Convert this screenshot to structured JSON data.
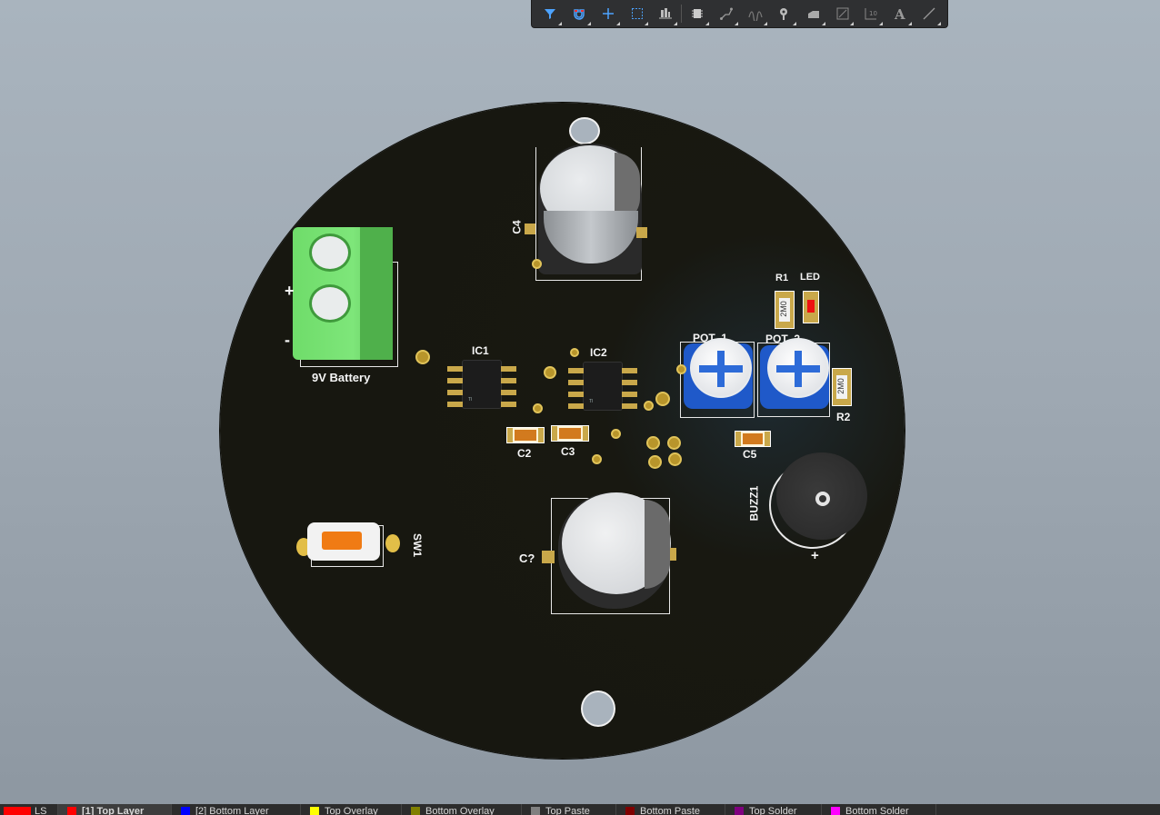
{
  "toolbar": {
    "tools": [
      "filter-icon",
      "magnet-icon",
      "crosshair-icon",
      "select-rect-icon",
      "align-icon",
      "component-icon",
      "route-icon",
      "wave-icon",
      "place-pad-icon",
      "fill-icon",
      "draw-rect-icon",
      "dimension-icon",
      "text-icon",
      "line-icon"
    ]
  },
  "board": {
    "labels": {
      "c4": "C4",
      "ic1": "IC1",
      "ic2": "IC2",
      "r1": "R1",
      "led": "LED",
      "pot1": "POT_1",
      "pot2": "POT_2",
      "r2": "R2",
      "c2": "C2",
      "c3": "C3",
      "c5": "C5",
      "cq": "C?",
      "buzz1": "BUZZ1",
      "sw1": "SW1",
      "battery": "9V Battery",
      "plus": "+",
      "minus": "-",
      "buzz_plus": "+"
    },
    "resistor_marking": "2M0"
  },
  "layers": {
    "items": [
      {
        "label": "LS",
        "color": "#ff0000"
      },
      {
        "label": "[1] Top Layer",
        "color": "#ff0000"
      },
      {
        "label": "[2] Bottom Layer",
        "color": "#0000ff"
      },
      {
        "label": "Top Overlay",
        "color": "#ffff00"
      },
      {
        "label": "Bottom Overlay",
        "color": "#808000"
      },
      {
        "label": "Top Paste",
        "color": "#808080"
      },
      {
        "label": "Bottom Paste",
        "color": "#800000"
      },
      {
        "label": "Top Solder",
        "color": "#800080"
      },
      {
        "label": "Bottom Solder",
        "color": "#ff00ff"
      }
    ]
  }
}
